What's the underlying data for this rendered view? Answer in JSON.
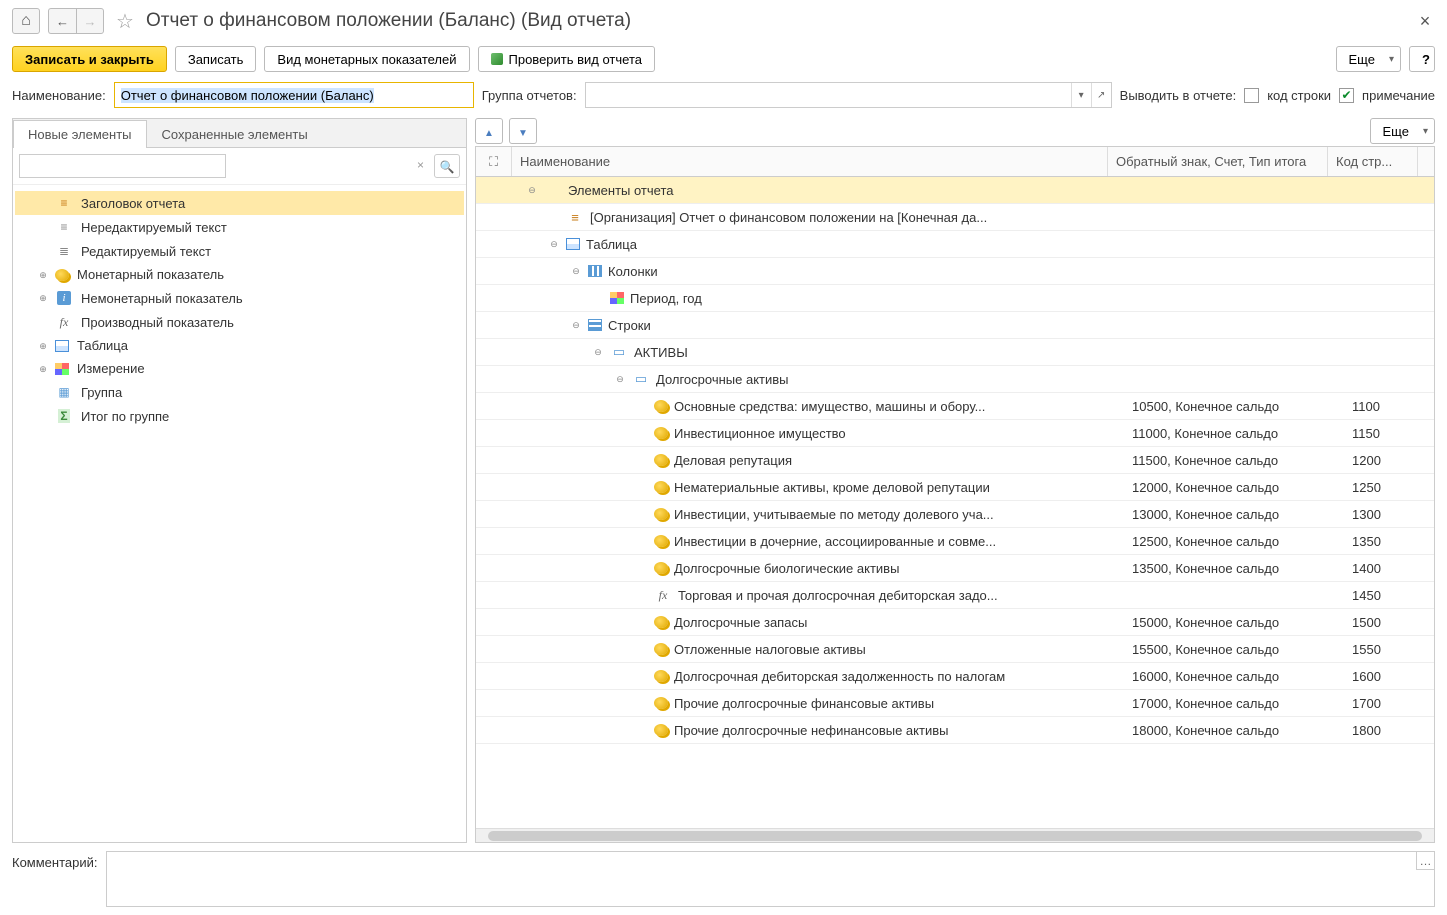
{
  "header": {
    "title": "Отчет о финансовом положении (Баланс) (Вид отчета)"
  },
  "toolbar": {
    "save_close": "Записать и закрыть",
    "save": "Записать",
    "monetary_view": "Вид монетарных показателей",
    "check_report": "Проверить вид отчета",
    "more": "Еще",
    "help": "?"
  },
  "form": {
    "name_label": "Наименование:",
    "name_value": "Отчет о финансовом положении (Баланс)",
    "group_label": "Группа отчетов:",
    "output_label": "Выводить в отчете:",
    "line_code_label": "код строки",
    "note_label": "примечание",
    "note_checked": true
  },
  "left": {
    "tab_new": "Новые элементы",
    "tab_saved": "Сохраненные элементы",
    "items": [
      {
        "icon": "header",
        "label": "Заголовок отчета",
        "selected": true
      },
      {
        "icon": "text",
        "label": "Нередактируемый текст"
      },
      {
        "icon": "edit-text",
        "label": "Редактируемый текст"
      },
      {
        "icon": "coins",
        "label": "Монетарный показатель",
        "expandable": true
      },
      {
        "icon": "info",
        "label": "Немонетарный показатель",
        "expandable": true
      },
      {
        "icon": "fx",
        "label": "Производный показатель"
      },
      {
        "icon": "table",
        "label": "Таблица",
        "expandable": true
      },
      {
        "icon": "grid",
        "label": "Измерение",
        "expandable": true
      },
      {
        "icon": "group",
        "label": "Группа"
      },
      {
        "icon": "sum",
        "label": "Итог по группе"
      }
    ]
  },
  "right": {
    "more": "Еще",
    "headers": {
      "name": "Наименование",
      "reverse": "Обратный знак, Счет, Тип итога",
      "code": "Код стр..."
    },
    "rows": [
      {
        "indent": 0,
        "toggle": "minus",
        "icon": "",
        "name": "Элементы отчета",
        "hi": true
      },
      {
        "indent": 1,
        "icon": "header",
        "name": "[Организация] Отчет о финансовом положении на [Конечная да..."
      },
      {
        "indent": 1,
        "toggle": "minus",
        "icon": "table",
        "name": "Таблица"
      },
      {
        "indent": 2,
        "toggle": "minus",
        "icon": "cols",
        "name": "Колонки"
      },
      {
        "indent": 3,
        "icon": "grid",
        "name": "Период, год"
      },
      {
        "indent": 2,
        "toggle": "minus",
        "icon": "rows",
        "name": "Строки"
      },
      {
        "indent": 3,
        "toggle": "minus",
        "icon": "section",
        "name": "АКТИВЫ"
      },
      {
        "indent": 4,
        "toggle": "minus",
        "icon": "section",
        "name": "Долгосрочные активы"
      },
      {
        "indent": 5,
        "icon": "coins",
        "name": "Основные средства: имущество, машины и обору...",
        "col2": "10500, Конечное сальдо",
        "col3": "1100"
      },
      {
        "indent": 5,
        "icon": "coins",
        "name": "Инвестиционное имущество",
        "col2": "11000, Конечное сальдо",
        "col3": "1150"
      },
      {
        "indent": 5,
        "icon": "coins",
        "name": "Деловая репутация",
        "col2": "11500, Конечное сальдо",
        "col3": "1200"
      },
      {
        "indent": 5,
        "icon": "coins",
        "name": "Нематериальные активы, кроме деловой репутации",
        "col2": "12000, Конечное сальдо",
        "col3": "1250"
      },
      {
        "indent": 5,
        "icon": "coins",
        "name": "Инвестиции, учитываемые по методу долевого уча...",
        "col2": "13000, Конечное сальдо",
        "col3": "1300"
      },
      {
        "indent": 5,
        "icon": "coins",
        "name": "Инвестиции в дочерние, ассоциированные и совме...",
        "col2": "12500, Конечное сальдо",
        "col3": "1350"
      },
      {
        "indent": 5,
        "icon": "coins",
        "name": "Долгосрочные биологические активы",
        "col2": "13500, Конечное сальдо",
        "col3": "1400"
      },
      {
        "indent": 5,
        "icon": "fx",
        "name": "Торговая и прочая долгосрочная дебиторская задо...",
        "col2": "",
        "col3": "1450"
      },
      {
        "indent": 5,
        "icon": "coins",
        "name": "Долгосрочные запасы",
        "col2": "15000, Конечное сальдо",
        "col3": "1500"
      },
      {
        "indent": 5,
        "icon": "coins",
        "name": "Отложенные налоговые активы",
        "col2": "15500, Конечное сальдо",
        "col3": "1550"
      },
      {
        "indent": 5,
        "icon": "coins",
        "name": "Долгосрочная дебиторская задолженность по налогам",
        "col2": "16000, Конечное сальдо",
        "col3": "1600"
      },
      {
        "indent": 5,
        "icon": "coins",
        "name": "Прочие долгосрочные финансовые активы",
        "col2": "17000, Конечное сальдо",
        "col3": "1700"
      },
      {
        "indent": 5,
        "icon": "coins",
        "name": "Прочие долгосрочные нефинансовые активы",
        "col2": "18000, Конечное сальдо",
        "col3": "1800"
      }
    ]
  },
  "footer": {
    "comment_label": "Комментарий:"
  }
}
